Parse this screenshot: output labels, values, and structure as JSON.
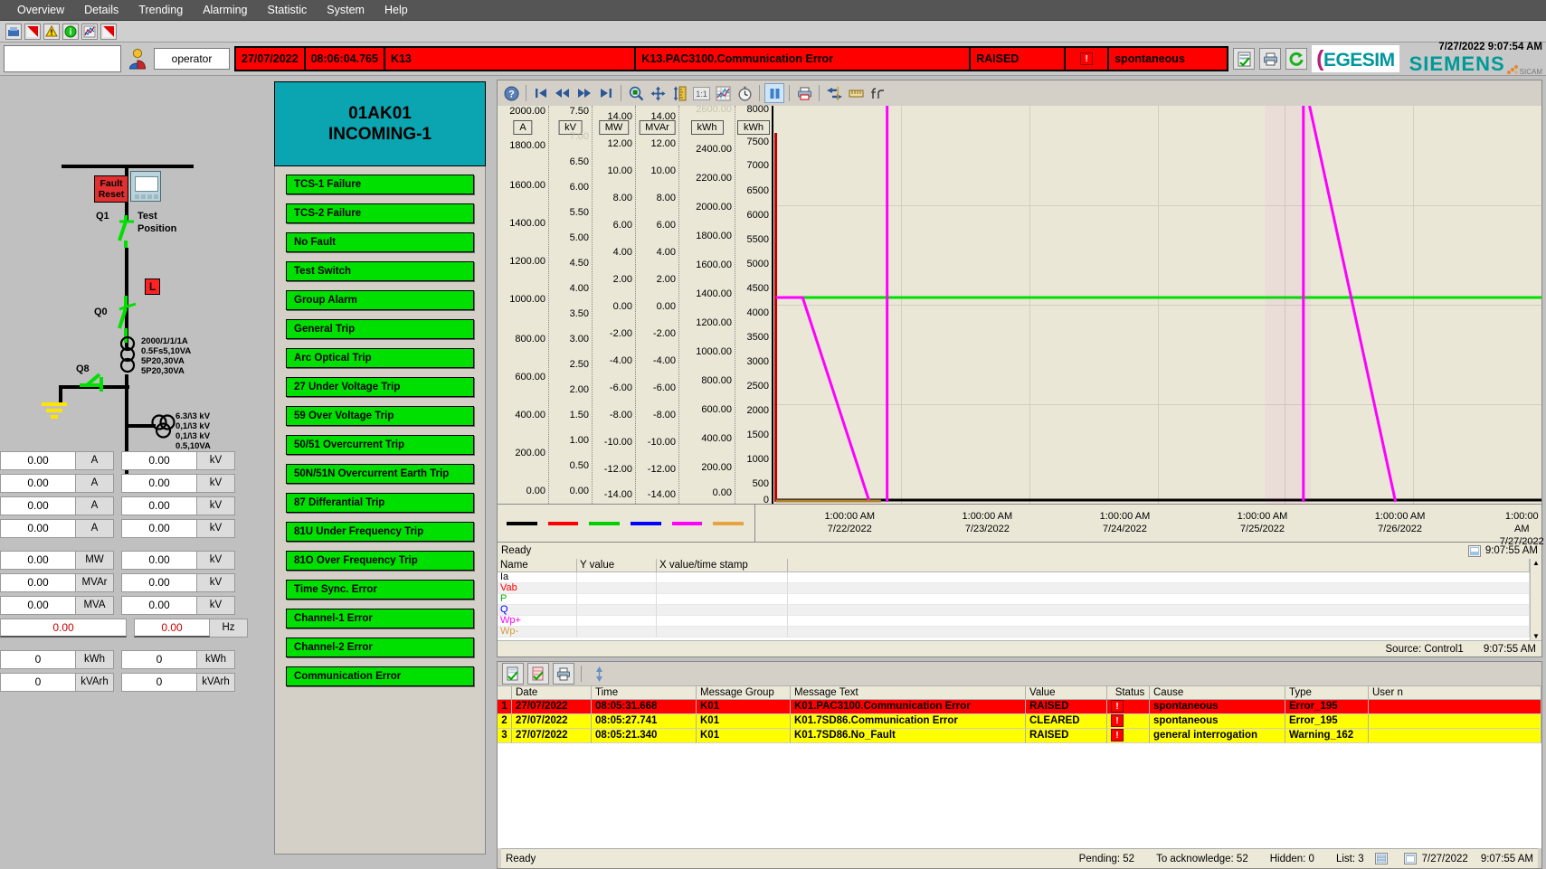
{
  "menu": {
    "items": [
      "Overview",
      "Details",
      "Trending",
      "Alarming",
      "Statistic",
      "System",
      "Help"
    ]
  },
  "toolbar1": {
    "icons": [
      "network-icon",
      "red-flag-icon",
      "warning-triangle-icon",
      "info-icon",
      "chart-icon",
      "red-flag2-icon"
    ]
  },
  "alarm_strip": {
    "operator_label": "operator",
    "date": "27/07/2022",
    "time": "08:06:04.765",
    "source": "K13",
    "message": "K13.PAC3100.Communication Error",
    "state": "RAISED",
    "alarm_glyph": "!",
    "cause": "spontaneous",
    "buttons": [
      "ack-all-icon",
      "print-icon",
      "refresh-icon"
    ],
    "brand_egesim": "EGESIM",
    "brand_siemens": "SIEMENS",
    "brand_sub": "SICAM",
    "clock": "7/27/2022 9:07:54 AM"
  },
  "diagram": {
    "fault_reset": "Fault\nReset",
    "fault_reset_l1": "Fault",
    "fault_reset_l2": "Reset",
    "q1": "Q1",
    "test_position_l1": "Test",
    "test_position_l2": "Position",
    "l_badge": "L",
    "q0": "Q0",
    "q8": "Q8",
    "ct_spec": [
      "2000/1/1/1A",
      "0.5Fs5,10VA",
      "5P20,30VA",
      "5P20,30VA"
    ],
    "vt_spec": [
      "6.3/\\3 kV",
      "0,1/\\3  kV",
      "0,1/\\3  kV",
      "0.5,10VA"
    ]
  },
  "measurements": {
    "left": [
      {
        "value": "0.00",
        "unit": "A"
      },
      {
        "value": "0.00",
        "unit": "A"
      },
      {
        "value": "0.00",
        "unit": "A"
      },
      {
        "value": "0.00",
        "unit": "A"
      }
    ],
    "right": [
      {
        "value": "0.00",
        "unit": "kV"
      },
      {
        "value": "0.00",
        "unit": "kV"
      },
      {
        "value": "0.00",
        "unit": "kV"
      },
      {
        "value": "0.00",
        "unit": "kV"
      }
    ],
    "left2": [
      {
        "value": "0.00",
        "unit": "MW"
      },
      {
        "value": "0.00",
        "unit": "MVAr"
      },
      {
        "value": "0.00",
        "unit": "MVA"
      }
    ],
    "right2": [
      {
        "value": "0.00",
        "unit": "kV"
      },
      {
        "value": "0.00",
        "unit": "kV"
      },
      {
        "value": "0.00",
        "unit": "kV"
      }
    ],
    "freq_left": {
      "value": "0.00",
      "unit": ""
    },
    "freq_right": {
      "value": "0.00",
      "unit": "Hz"
    },
    "energy_left": [
      {
        "value": "0",
        "unit": "kWh"
      },
      {
        "value": "0",
        "unit": "kVArh"
      }
    ],
    "energy_right": [
      {
        "value": "0",
        "unit": "kWh"
      },
      {
        "value": "0",
        "unit": "kVArh"
      }
    ]
  },
  "bay": {
    "title_line1": "01AK01",
    "title_line2": "INCOMING-1",
    "signals": [
      "TCS-1 Failure",
      "TCS-2 Failure",
      "No Fault",
      "Test Switch",
      "Group Alarm",
      "General Trip",
      "Arc Optical Trip",
      "27 Under Voltage Trip",
      "59 Over Voltage Trip",
      "50/51 Overcurrent Trip",
      "50N/51N Overcurrent Earth Trip",
      "87 Differantial Trip",
      "81U Under Frequency Trip",
      "81O Over Frequency Trip",
      "Time Sync. Error",
      "Channel-1 Error",
      "Channel-2 Error",
      "Communication Error"
    ]
  },
  "trend_toolbar": {
    "icons": [
      "help-icon",
      "first-icon",
      "rewind-icon",
      "forward-icon",
      "last-icon",
      "zoom-icon",
      "pan-icon",
      "zoom-y-icon",
      "one-to-one-icon",
      "grid-icon",
      "time-icon",
      "pause-icon",
      "print-icon",
      "swap-axes-icon",
      "ruler-icon",
      "function-icon"
    ]
  },
  "chart_data": {
    "type": "line",
    "title": "",
    "xlabel": "",
    "ylabel": "",
    "grid": true,
    "legend_position": "bottom-left",
    "axes": [
      {
        "unit": "A",
        "color": "#000000",
        "min": 0,
        "max": 2000,
        "ticks": [
          "2000.00",
          "1800.00",
          "1600.00",
          "1400.00",
          "1200.00",
          "1000.00",
          "800.00",
          "600.00",
          "400.00",
          "200.00",
          "0.00"
        ]
      },
      {
        "unit": "kV",
        "color": "#d00000",
        "min": 0,
        "max": 7.5,
        "ticks": [
          "7.50",
          "7.00",
          "6.50",
          "6.00",
          "5.50",
          "5.00",
          "4.50",
          "4.00",
          "3.50",
          "3.00",
          "2.50",
          "2.00",
          "1.50",
          "1.00",
          "0.50",
          "0.00"
        ]
      },
      {
        "unit": "MW",
        "color": "#00c000",
        "min": -14,
        "max": 14,
        "ticks": [
          "14.00",
          "12.00",
          "10.00",
          "8.00",
          "6.00",
          "4.00",
          "2.00",
          "0.00",
          "-2.00",
          "-4.00",
          "-6.00",
          "-8.00",
          "-10.00",
          "-12.00",
          "-14.00"
        ]
      },
      {
        "unit": "MVAr",
        "color": "#0000d0",
        "min": -14,
        "max": 14,
        "ticks": [
          "14.00",
          "12.00",
          "10.00",
          "8.00",
          "6.00",
          "4.00",
          "2.00",
          "0.00",
          "-2.00",
          "-4.00",
          "-6.00",
          "-8.00",
          "-10.00",
          "-12.00",
          "-14.00"
        ]
      },
      {
        "unit": "kWh",
        "color": "#ff00ff",
        "min": 0,
        "max": 2600,
        "ticks": [
          "2600.00",
          "2400.00",
          "2200.00",
          "2000.00",
          "1800.00",
          "1600.00",
          "1400.00",
          "1200.00",
          "1000.00",
          "800.00",
          "600.00",
          "400.00",
          "200.00",
          "0.00"
        ]
      },
      {
        "unit": "kWh",
        "color": "#e8a33d",
        "min": 0,
        "max": 8000,
        "ticks": [
          "8000",
          "7500",
          "7000",
          "6500",
          "6000",
          "5500",
          "5000",
          "4500",
          "4000",
          "3500",
          "3000",
          "2500",
          "2000",
          "1500",
          "1000",
          "500",
          "0"
        ]
      }
    ],
    "x_ticks": [
      {
        "time": "1:00:00 AM",
        "date": "7/22/2022"
      },
      {
        "time": "1:00:00 AM",
        "date": "7/23/2022"
      },
      {
        "time": "1:00:00 AM",
        "date": "7/24/2022"
      },
      {
        "time": "1:00:00 AM",
        "date": "7/25/2022"
      },
      {
        "time": "1:00:00 AM",
        "date": "7/26/2022"
      },
      {
        "time": "1:00:00 AM",
        "date": "7/27/2022"
      }
    ],
    "series": [
      {
        "name": "Ia",
        "color": "#000000"
      },
      {
        "name": "Vab",
        "color": "#ff0000"
      },
      {
        "name": "P",
        "color": "#00d000"
      },
      {
        "name": "Q",
        "color": "#0000ff"
      },
      {
        "name": "Wp+",
        "color": "#ff00ff"
      },
      {
        "name": "Wp-",
        "color": "#e8a33d"
      }
    ],
    "legend_colors": [
      "#000000",
      "#ff0000",
      "#00d000",
      "#0000ff",
      "#ff00ff",
      "#e8a33d"
    ]
  },
  "trend_status": {
    "ready": "Ready",
    "time": "9:07:55 AM"
  },
  "value_table": {
    "headers": [
      "Name",
      "Y value",
      "X value/time stamp",
      ""
    ],
    "rows": [
      {
        "name": "Ia",
        "color": "#000000",
        "y": "",
        "x": ""
      },
      {
        "name": "Vab",
        "color": "#ff0000",
        "y": "",
        "x": ""
      },
      {
        "name": "P",
        "color": "#00b000",
        "y": "",
        "x": ""
      },
      {
        "name": "Q",
        "color": "#0000ff",
        "y": "",
        "x": ""
      },
      {
        "name": "Wp+",
        "color": "#ff00ff",
        "y": "",
        "x": ""
      },
      {
        "name": "Wp-",
        "color": "#d69a3a",
        "y": "",
        "x": ""
      }
    ],
    "source": "Source: Control1",
    "source_time": "9:07:55 AM"
  },
  "alarm_toolbar": {
    "icons": [
      "ack-icon",
      "ack-group-icon",
      "print-icon",
      "sort-icon"
    ]
  },
  "alarm_table": {
    "headers": [
      "",
      "Date",
      "Time",
      "Message Group",
      "Message Text",
      "Value",
      "Status",
      "Cause",
      "Type",
      "User n"
    ],
    "rows": [
      {
        "no": "1",
        "date": "27/07/2022",
        "time": "08:05:31.668",
        "group": "K01",
        "text": "K01.PAC3100.Communication Error",
        "value": "RAISED",
        "status": "!",
        "cause": "spontaneous",
        "type": "Error_195",
        "user": "",
        "bg": "#ff0000",
        "fg": "#000000"
      },
      {
        "no": "2",
        "date": "27/07/2022",
        "time": "08:05:27.741",
        "group": "K01",
        "text": "K01.7SD86.Communication Error",
        "value": "CLEARED",
        "status": "!",
        "cause": "spontaneous",
        "type": "Error_195",
        "user": "",
        "bg": "#ffff00",
        "fg": "#000000"
      },
      {
        "no": "3",
        "date": "27/07/2022",
        "time": "08:05:21.340",
        "group": "K01",
        "text": "K01.7SD86.No_Fault",
        "value": "RAISED",
        "status": "!",
        "cause": "general interrogation",
        "type": "Warning_162",
        "user": "",
        "bg": "#ffff00",
        "fg": "#000000"
      }
    ]
  },
  "bottom_bar": {
    "ready": "Ready",
    "pending": "Pending: 52",
    "to_ack": "To acknowledge: 52",
    "hidden": "Hidden: 0",
    "list": "List: 3",
    "date": "7/27/2022",
    "time": "9:07:55 AM"
  }
}
